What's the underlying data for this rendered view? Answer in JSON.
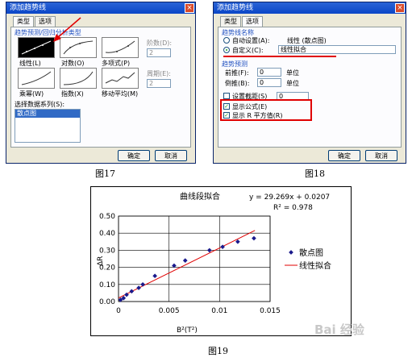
{
  "dialog1": {
    "title": "添加趋势线",
    "close": "×",
    "tabs": [
      "类型",
      "选项"
    ],
    "group_label": "趋势预测/回归分析类型",
    "types": [
      "线性(L)",
      "对数(O)",
      "多项式(P)",
      "乘幂(W)",
      "指数(X)",
      "移动平均(M)"
    ],
    "order_label": "阶数(D):",
    "order_value": "2",
    "period_label": "周期(E):",
    "period_value": "2",
    "series_label": "选择数据系列(S):",
    "series_selected": "散点图",
    "ok": "确定",
    "cancel": "取消"
  },
  "dialog2": {
    "title": "添加趋势线",
    "close": "×",
    "tabs": [
      "类型",
      "选项"
    ],
    "name_group": "趋势线名称",
    "auto_label": "自动设置(A):",
    "auto_value": "线性 (散点图)",
    "custom_label": "自定义(C):",
    "custom_value": "线性拟合",
    "forecast_group": "趋势预测",
    "forward_label": "前推(F):",
    "forward_value": "0",
    "backward_label": "倒推(B):",
    "backward_value": "0",
    "unit": "单位",
    "intercept_label": "设置截距(S)",
    "intercept_value": "0",
    "show_eq_label": "显示公式(E)",
    "show_r2_label": "显示 R 平方值(R)",
    "ok": "确定",
    "cancel": "取消"
  },
  "captions": {
    "fig17": "图17",
    "fig18": "图18",
    "fig19": "图19"
  },
  "watermark": "Bai 经验",
  "chart_data": {
    "type": "scatter",
    "title": "曲线段拟合",
    "equation": "y = 29.269x + 0.0207",
    "r2": "R² = 0.978",
    "xlabel": "B²(T²)",
    "ylabel": "ΔR",
    "xlim": [
      0,
      0.015
    ],
    "ylim": [
      0,
      0.5
    ],
    "x_ticks": [
      "0",
      "0.005",
      "0.01",
      "0.015"
    ],
    "y_ticks": [
      "0.00",
      "0.10",
      "0.20",
      "0.30",
      "0.40",
      "0.50"
    ],
    "grid": true,
    "legend_position": "right",
    "series": [
      {
        "name": "散点图",
        "color": "#1a1a8c",
        "x": [
          0.0002,
          0.0005,
          0.0008,
          0.0013,
          0.002,
          0.0024,
          0.0036,
          0.0055,
          0.0066,
          0.009,
          0.0103,
          0.0118,
          0.0134
        ],
        "y": [
          0.01,
          0.02,
          0.04,
          0.06,
          0.08,
          0.1,
          0.15,
          0.21,
          0.24,
          0.3,
          0.32,
          0.35,
          0.37
        ]
      },
      {
        "name": "线性拟合",
        "color": "#e00000",
        "slope": 29.269,
        "intercept": 0.0207
      }
    ]
  }
}
